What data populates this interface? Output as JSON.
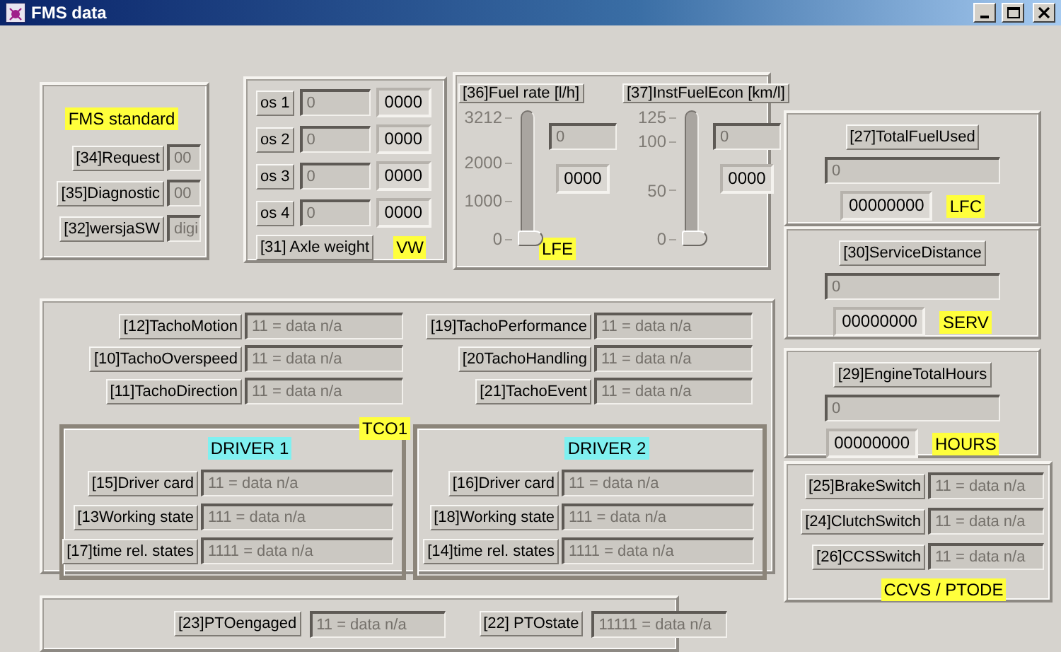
{
  "window": {
    "title": "FMS data"
  },
  "fms_standard": {
    "tag": "FMS standard",
    "rows": [
      {
        "label": "[34]Request",
        "value": "00"
      },
      {
        "label": "[35]Diagnostic",
        "value": "00"
      },
      {
        "label": "[32]wersjaSW",
        "value": "digi"
      }
    ]
  },
  "axles": {
    "rows": [
      {
        "label": "os 1",
        "value": "0",
        "reading": "0000"
      },
      {
        "label": "os 2",
        "value": "0",
        "reading": "0000"
      },
      {
        "label": "os 3",
        "value": "0",
        "reading": "0000"
      },
      {
        "label": "os 4",
        "value": "0",
        "reading": "0000"
      }
    ],
    "label": "[31] Axle weight",
    "tag": "VW"
  },
  "fuel": {
    "gauges": [
      {
        "label": "[36]Fuel rate [l/h]",
        "ticks": [
          "3212",
          "2000",
          "1000",
          "0"
        ],
        "level": 0,
        "value": "0",
        "reading": "0000"
      },
      {
        "label": "[37]InstFuelEcon [km/l]",
        "ticks": [
          "125",
          "100",
          "50",
          "0"
        ],
        "level": 0,
        "value": "0",
        "reading": "0000"
      }
    ],
    "tag": "LFE"
  },
  "counters": [
    {
      "label": "[27]TotalFuelUsed",
      "value": "0",
      "reading": "00000000",
      "tag": "LFC"
    },
    {
      "label": "[30]ServiceDistance",
      "value": "0",
      "reading": "00000000",
      "tag": "SERV"
    },
    {
      "label": "[29]EngineTotalHours",
      "value": "0",
      "reading": "00000000",
      "tag": "HOURS"
    }
  ],
  "tacho": {
    "rows_left": [
      {
        "label": "[12]TachoMotion",
        "value": "11 = data n/a"
      },
      {
        "label": "[10]TachoOverspeed",
        "value": "11 = data n/a"
      },
      {
        "label": "[11]TachoDirection",
        "value": "11 = data n/a"
      }
    ],
    "rows_right": [
      {
        "label": "[19]TachoPerformance",
        "value": "11 = data n/a"
      },
      {
        "label": "[20TachoHandling",
        "value": "11 = data n/a"
      },
      {
        "label": "[21]TachoEvent",
        "value": "11 = data n/a"
      }
    ],
    "tag": "TCO1",
    "drivers": [
      {
        "title": "DRIVER 1",
        "rows": [
          {
            "label": "[15]Driver card",
            "value": "11 = data n/a"
          },
          {
            "label": "[13Working state",
            "value": "111 = data n/a"
          },
          {
            "label": "[17]time rel. states",
            "value": "1111 = data n/a"
          }
        ]
      },
      {
        "title": "DRIVER 2",
        "rows": [
          {
            "label": "[16]Driver card",
            "value": "11 = data n/a"
          },
          {
            "label": "[18]Working state",
            "value": "111 = data n/a"
          },
          {
            "label": "[14]time rel. states",
            "value": "1111 = data n/a"
          }
        ]
      }
    ]
  },
  "switches": {
    "rows": [
      {
        "label": "[25]BrakeSwitch",
        "value": "11 = data n/a"
      },
      {
        "label": "[24]ClutchSwitch",
        "value": "11 = data n/a"
      },
      {
        "label": "[26]CCSSwitch",
        "value": "11 = data n/a"
      }
    ],
    "tag": "CCVS / PTODE"
  },
  "pto": {
    "rows": [
      {
        "label": "[23]PTOengaged",
        "value": "11 = data n/a"
      },
      {
        "label": "[22] PTOstate",
        "value": "11111 = data n/a"
      }
    ]
  }
}
